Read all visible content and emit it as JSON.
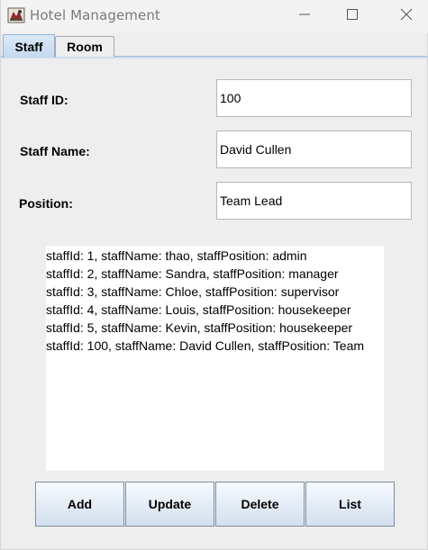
{
  "window": {
    "title": "Hotel Management"
  },
  "tabs": [
    {
      "label": "Staff",
      "selected": true
    },
    {
      "label": "Room",
      "selected": false
    }
  ],
  "form": {
    "staff_id_label": "Staff ID:",
    "staff_id_value": "100",
    "staff_name_label": "Staff Name:",
    "staff_name_value": "David Cullen",
    "position_label": "Position:",
    "position_value": "Team Lead"
  },
  "list": {
    "items": [
      "staffId: 1, staffName: thao, staffPosition: admin",
      "staffId: 2, staffName: Sandra, staffPosition: manager",
      "staffId: 3, staffName: Chloe, staffPosition: supervisor",
      "staffId: 4, staffName: Louis, staffPosition: housekeeper",
      "staffId: 5, staffName: Kevin, staffPosition: housekeeper",
      "staffId: 100, staffName: David Cullen, staffPosition: Team"
    ]
  },
  "buttons": {
    "add": "Add",
    "update": "Update",
    "delete": "Delete",
    "list": "List"
  },
  "icons": {
    "app": "hotel-app-icon",
    "minimize": "minimize-icon",
    "maximize": "maximize-icon",
    "close": "close-icon"
  },
  "colors": {
    "selected_tab": "#c6daf0",
    "button_gradient_end": "#d3e0ee"
  }
}
